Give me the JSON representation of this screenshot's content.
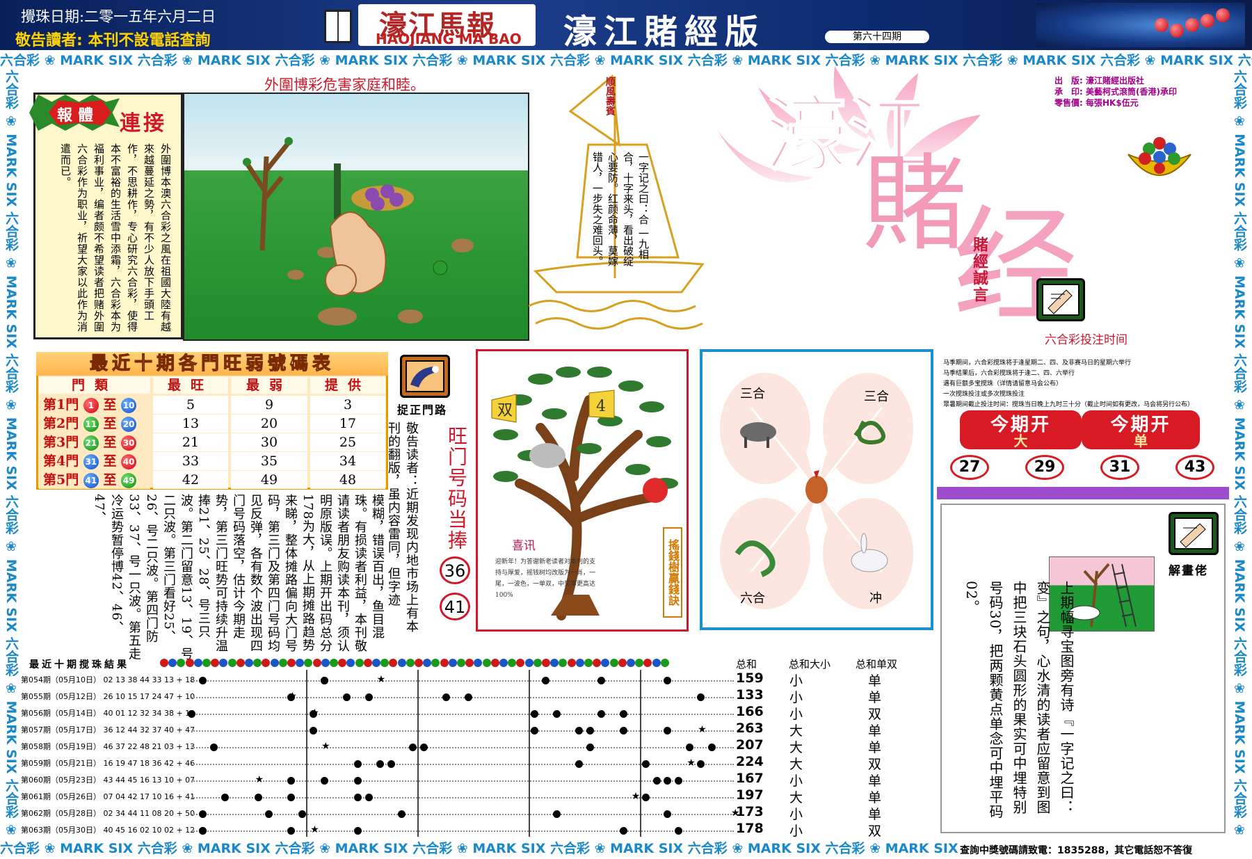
{
  "header": {
    "date": "攪珠日期:二零一五年六月二日",
    "warning": "敬告讀者: 本刊不設電話查詢",
    "logo_cn": "濠江馬報",
    "logo_en": "HAOJIANG MA BAO",
    "title": "濠江賭經版",
    "issue": "第六十四期"
  },
  "strip": {
    "text": "六合彩 ❀ MARK SIX"
  },
  "headline": "外圍博彩危害家庭和睦。",
  "story": {
    "badge": "報體",
    "badge_side": "連接",
    "text": "外圍博本澳六合彩之風在祖國大陸有越來越蔓延之勢，有不少人放下手頭工作，不思耕作，专心研究六合彩，使得本不富裕的生活雪中添霜，六合彩本为福利事业，编者颇不希望读者把赌外圍六合彩作为职业，祈望大家以此作为消遣而已。"
  },
  "boat": {
    "flag": "順風壽賓",
    "poem": "一字记之曰：合 一九相合，十字来头，看出破绽心要防。红颜命薄，莫嫁错人，一步失之难回头。"
  },
  "publisher": {
    "lines": [
      {
        "label": "出　版:",
        "value": "濠江賭經出版社"
      },
      {
        "label": "承　印:",
        "value": "美藝柯式滾筒(香港)承印"
      },
      {
        "label": "零售價:",
        "value": "每張HK$伍元"
      }
    ],
    "motto": "賭經誠言",
    "big_title_1": "濠江",
    "big_title_2": "賭",
    "big_title_3": "经",
    "bet_time": "六合彩投注时间"
  },
  "table": {
    "title": "最近十期各門旺弱號碼表",
    "headers": [
      "門類",
      "最旺",
      "最弱",
      "提供"
    ],
    "rows": [
      {
        "label": "第1門",
        "from": "1",
        "to": "10",
        "fc": "r",
        "tc": "b",
        "max": "5",
        "min": "9",
        "give": "3"
      },
      {
        "label": "第2門",
        "from": "11",
        "to": "20",
        "fc": "g",
        "tc": "b",
        "max": "13",
        "min": "20",
        "give": "17"
      },
      {
        "label": "第3門",
        "from": "21",
        "to": "30",
        "fc": "g",
        "tc": "r",
        "max": "21",
        "min": "30",
        "give": "25"
      },
      {
        "label": "第4門",
        "from": "31",
        "to": "40",
        "fc": "b",
        "tc": "r",
        "max": "33",
        "min": "35",
        "give": "34"
      },
      {
        "label": "第5門",
        "from": "41",
        "to": "49",
        "fc": "b",
        "tc": "g",
        "max": "42",
        "min": "49",
        "give": "48"
      }
    ],
    "zhi": "至"
  },
  "notice": {
    "text": "模糊，错误百出，鱼目混珠。有损读者利益，本刊敬请读者朋友购读本刊，须认明原版误。上期开出码总分178为大，从上期摊路趋势来睇，整体摊路偏向大门号码，第三门及第四门号码均见反弹，各有数个波出现四门号码落空，估计今期走势，第三门旺势可持续升温捧21、25、28、号三只波。第二门留意13、19、号二只波。第三门看好25、26、号二只波。第四门防33、37、号一只波。第五走冷运势暂停博42、46、47、",
    "note2": "敬告读者：近期发现内地市场上有本刊的翻版，虽内容雷同，但字迹",
    "zhengmen": "捉正門路",
    "wangmen": "旺门号码当捧",
    "num1": "36",
    "num2": "41"
  },
  "tree": {
    "tag_left": "双",
    "tag_right": "4",
    "xixun": "喜讯",
    "xixun_text": "迎新年！为答谢新老读者对本刊的支持与厚爱，摇钱树均改版为一肖，一尾，一波色，一单双，中奖率更高达100%",
    "yaoqian": "搖錢樹贏錢訣"
  },
  "zodiac": {
    "tl": "三合",
    "tr": "三合",
    "bl": "六合",
    "br": "冲"
  },
  "rules": [
    "马季期间，六合彩搅珠将于逢星期二、四、及非赛马日的星期六举行",
    "马季结果后，六合彩搅珠将于逢二、四、六举行",
    "遇有巨额多宝搅珠（详情请留意马会公布）",
    "一次搅珠投注或多次搅珠投注",
    "  眾暑期间截止投注时间：搅珠当日晚上九时三十分（截止时间如有更改，马会将另行公布）"
  ],
  "kaijiang": {
    "label": "今期开",
    "left_sub": "大",
    "right_sub": "单",
    "numbers": [
      "27",
      "29",
      "31",
      "43"
    ]
  },
  "jiehua": {
    "label": "解畫佬",
    "text": "上期幅寻宝图旁有诗『一字记之曰：变』之句，心水清的读者应留意到图中把三块石头圆形的果实可中埋特别号码30，把两颗黄点单念可中埋平码02。"
  },
  "results": {
    "title": "最近十期搅珠結果",
    "col_sum": "总和",
    "col_dx": "总和大小",
    "col_ds": "总和单双",
    "rows": [
      {
        "period": "第054期（05月10日）",
        "nums": "02 13 38 44 33 13 + 18",
        "sum": "159",
        "dx": "小",
        "ds": "单"
      },
      {
        "period": "第055期（05月12日）",
        "nums": "26 10 15 17 24 47 + 10",
        "sum": "133",
        "dx": "小",
        "ds": "单"
      },
      {
        "period": "第056期（05月14日）",
        "nums": "40 01 12 32 34 38 + 12",
        "sum": "166",
        "dx": "小",
        "ds": "双"
      },
      {
        "period": "第057期（05月17日）",
        "nums": "36 12 44 32 37 40 + 47",
        "sum": "263",
        "dx": "大",
        "ds": "单"
      },
      {
        "period": "第058期（05月19日）",
        "nums": "46 37 22 48 21 03 + 13",
        "sum": "207",
        "dx": "大",
        "ds": "单"
      },
      {
        "period": "第059期（05月21日）",
        "nums": "16 19 47 18 36 42 + 46",
        "sum": "224",
        "dx": "大",
        "ds": "双"
      },
      {
        "period": "第060期（05月23日）",
        "nums": "43 44 45 16 13 10 + 07",
        "sum": "167",
        "dx": "小",
        "ds": "单"
      },
      {
        "period": "第061期（05月26日）",
        "nums": "07 04 42 17 10 16 + 41",
        "sum": "197",
        "dx": "大",
        "ds": "单"
      },
      {
        "period": "第062期（05月28日）",
        "nums": "02 34 44 11 08 20 + 50",
        "sum": "173",
        "dx": "小",
        "ds": "单"
      },
      {
        "period": "第063期（05月30日）",
        "nums": "40 45 16 02 10 02 + 12",
        "sum": "178",
        "dx": "小",
        "ds": "双"
      }
    ]
  },
  "bottom_note": "查詢中獎號碼請致電：1835288，其它電話恕不答復"
}
